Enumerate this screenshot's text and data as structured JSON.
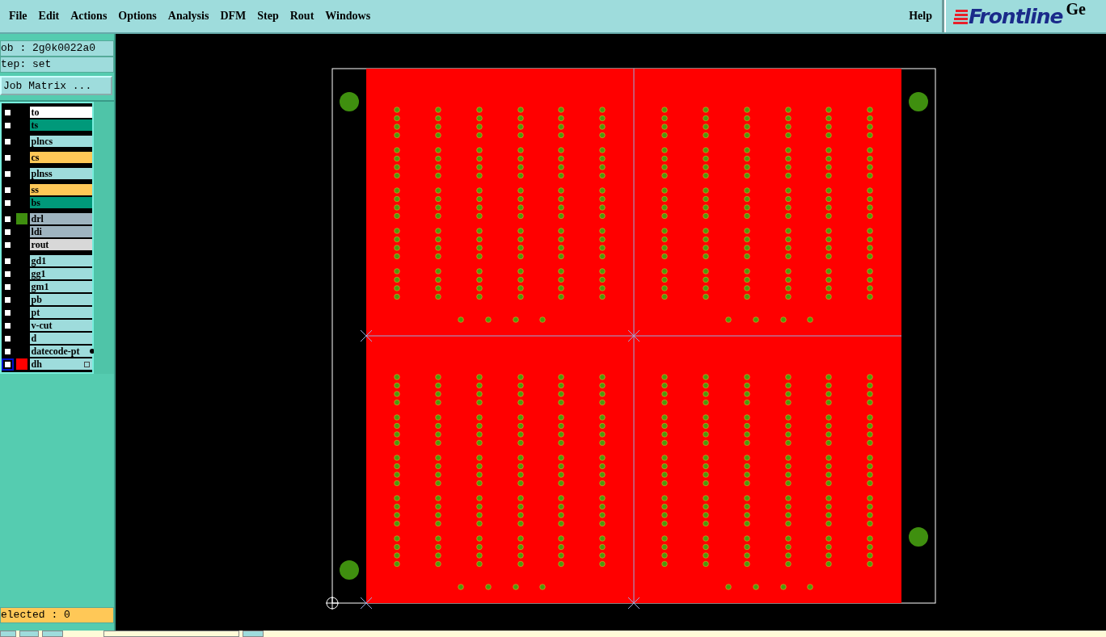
{
  "menu": [
    {
      "label": "File"
    },
    {
      "label": "Edit"
    },
    {
      "label": "Actions"
    },
    {
      "label": "Options"
    },
    {
      "label": "Analysis"
    },
    {
      "label": "DFM"
    },
    {
      "label": "Step"
    },
    {
      "label": "Rout"
    },
    {
      "label": "Windows"
    }
  ],
  "help": "Help",
  "logo": {
    "text": "Frontline",
    "suffix": "Ge"
  },
  "job": "ob : 2g0k0022a0",
  "step": "tep: set",
  "job_matrix_button": "Job Matrix ...",
  "layer_groups": [
    [
      {
        "name": "to",
        "color": "#ffffff",
        "checked": false,
        "selected": false
      },
      {
        "name": "ts",
        "color": "#00997a",
        "checked": false,
        "selected": false
      }
    ],
    [
      {
        "name": "plncs",
        "color": "#9edcdc",
        "checked": false,
        "selected": false
      }
    ],
    [
      {
        "name": "cs",
        "color": "#ffc857",
        "checked": false,
        "selected": false
      }
    ],
    [
      {
        "name": "plnss",
        "color": "#9edcdc",
        "checked": false,
        "selected": false
      }
    ],
    [
      {
        "name": "ss",
        "color": "#ffc857",
        "checked": false,
        "selected": false
      },
      {
        "name": "bs",
        "color": "#00997a",
        "checked": false,
        "selected": false
      }
    ],
    [
      {
        "name": "drl",
        "color": "#9fb4c0",
        "checked": false,
        "selected": false,
        "swatch": {
          "color": "#3f8f0f"
        }
      },
      {
        "name": "ldi",
        "color": "#9fb4c0",
        "checked": false,
        "selected": false
      },
      {
        "name": "rout",
        "color": "#d8d8d8",
        "checked": false,
        "selected": false
      }
    ],
    [
      {
        "name": "gd1",
        "color": "#9edcdc",
        "checked": false,
        "selected": false
      },
      {
        "name": "gg1",
        "color": "#9edcdc",
        "checked": false,
        "selected": false
      },
      {
        "name": "gm1",
        "color": "#9edcdc",
        "checked": false,
        "selected": false
      },
      {
        "name": "pb",
        "color": "#9edcdc",
        "checked": false,
        "selected": false
      },
      {
        "name": "pt",
        "color": "#9edcdc",
        "checked": false,
        "selected": false
      },
      {
        "name": "v-cut",
        "color": "#9edcdc",
        "checked": false,
        "selected": false
      },
      {
        "name": "d",
        "color": "#9edcdc",
        "checked": false,
        "selected": false
      },
      {
        "name": "datecode-pt",
        "color": "#9edcdc",
        "checked": false,
        "selected": false
      },
      {
        "name": "dh",
        "color": "#9edcdc",
        "checked": false,
        "selected": true,
        "swatch": {
          "color": "#ff0000"
        }
      }
    ]
  ],
  "selected_count": "elected : 0"
}
